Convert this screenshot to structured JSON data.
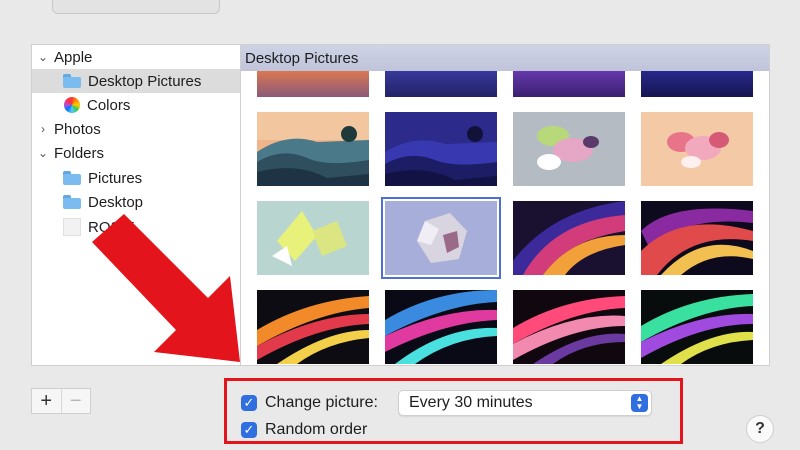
{
  "sidebar": {
    "items": [
      {
        "label": "Apple",
        "kind": "group",
        "expanded": true
      },
      {
        "label": "Desktop Pictures",
        "kind": "folder",
        "selected": true
      },
      {
        "label": "Colors",
        "kind": "colors"
      },
      {
        "label": "Photos",
        "kind": "group",
        "expanded": false
      },
      {
        "label": "Folders",
        "kind": "group",
        "expanded": true
      },
      {
        "label": "Pictures",
        "kind": "folder"
      },
      {
        "label": "Desktop",
        "kind": "folder"
      },
      {
        "label": "ROSIE",
        "kind": "blank"
      }
    ]
  },
  "pane": {
    "title": "Desktop Pictures",
    "thumbnails": [
      {
        "name": "big-sur-coastline-day"
      },
      {
        "name": "big-sur-coastline-night"
      },
      {
        "name": "abstract-shapes-gray"
      },
      {
        "name": "abstract-shapes-peach"
      },
      {
        "name": "abstract-crystals-mint"
      },
      {
        "name": "abstract-dodecahedron-lavender",
        "selected": true
      },
      {
        "name": "monterey-dark-1"
      },
      {
        "name": "monterey-dark-2"
      },
      {
        "name": "streaks-orange"
      },
      {
        "name": "streaks-blue"
      },
      {
        "name": "streaks-pink"
      },
      {
        "name": "streaks-green"
      }
    ]
  },
  "controls": {
    "add_label": "+",
    "remove_label": "−",
    "change_picture_label": "Change picture:",
    "change_picture_checked": true,
    "interval_value": "Every 30 minutes",
    "random_order_label": "Random order",
    "random_order_checked": true,
    "help_label": "?"
  },
  "colors": {
    "accent": "#2f6fe0",
    "highlight_box": "#e3141b",
    "annotation_arrow": "#e3141b"
  }
}
